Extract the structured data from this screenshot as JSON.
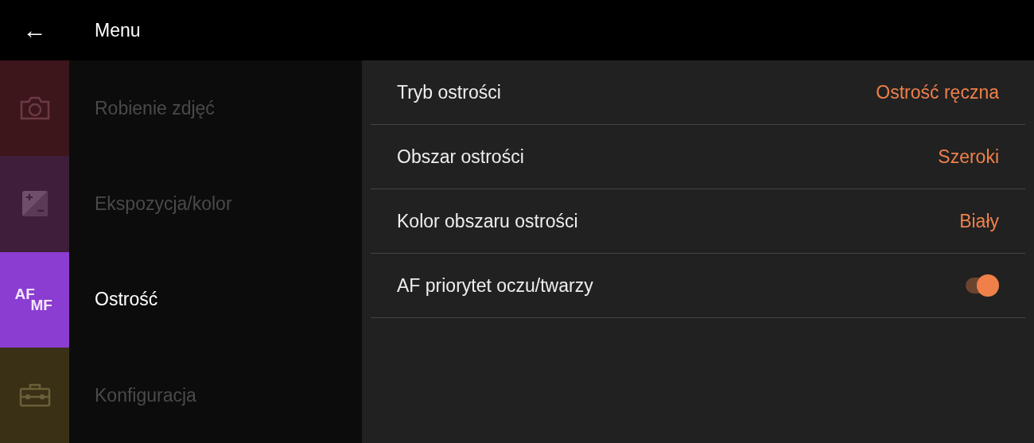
{
  "header": {
    "back_icon": "←",
    "title": "Menu"
  },
  "categories": [
    {
      "kind": "camera",
      "label": "Robienie zdjęć",
      "color": "#3d161c",
      "selected": false
    },
    {
      "kind": "exposure",
      "label": "Ekspozycja/kolor",
      "color": "#3e1e3a",
      "selected": false
    },
    {
      "kind": "focus",
      "label": "Ostrość",
      "color": "#8a3dd0",
      "selected": true,
      "icon_text": [
        "AF",
        "MF"
      ]
    },
    {
      "kind": "toolbox",
      "label": "Konfiguracja",
      "color": "#3a3015",
      "selected": false
    }
  ],
  "settings": [
    {
      "kind": "value",
      "label": "Tryb ostrości",
      "value": "Ostrość ręczna"
    },
    {
      "kind": "value",
      "label": "Obszar ostrości",
      "value": "Szeroki"
    },
    {
      "kind": "value",
      "label": "Kolor obszaru ostrości",
      "value": "Biały"
    },
    {
      "kind": "toggle",
      "label": "AF priorytet oczu/twarzy",
      "on": true
    }
  ]
}
